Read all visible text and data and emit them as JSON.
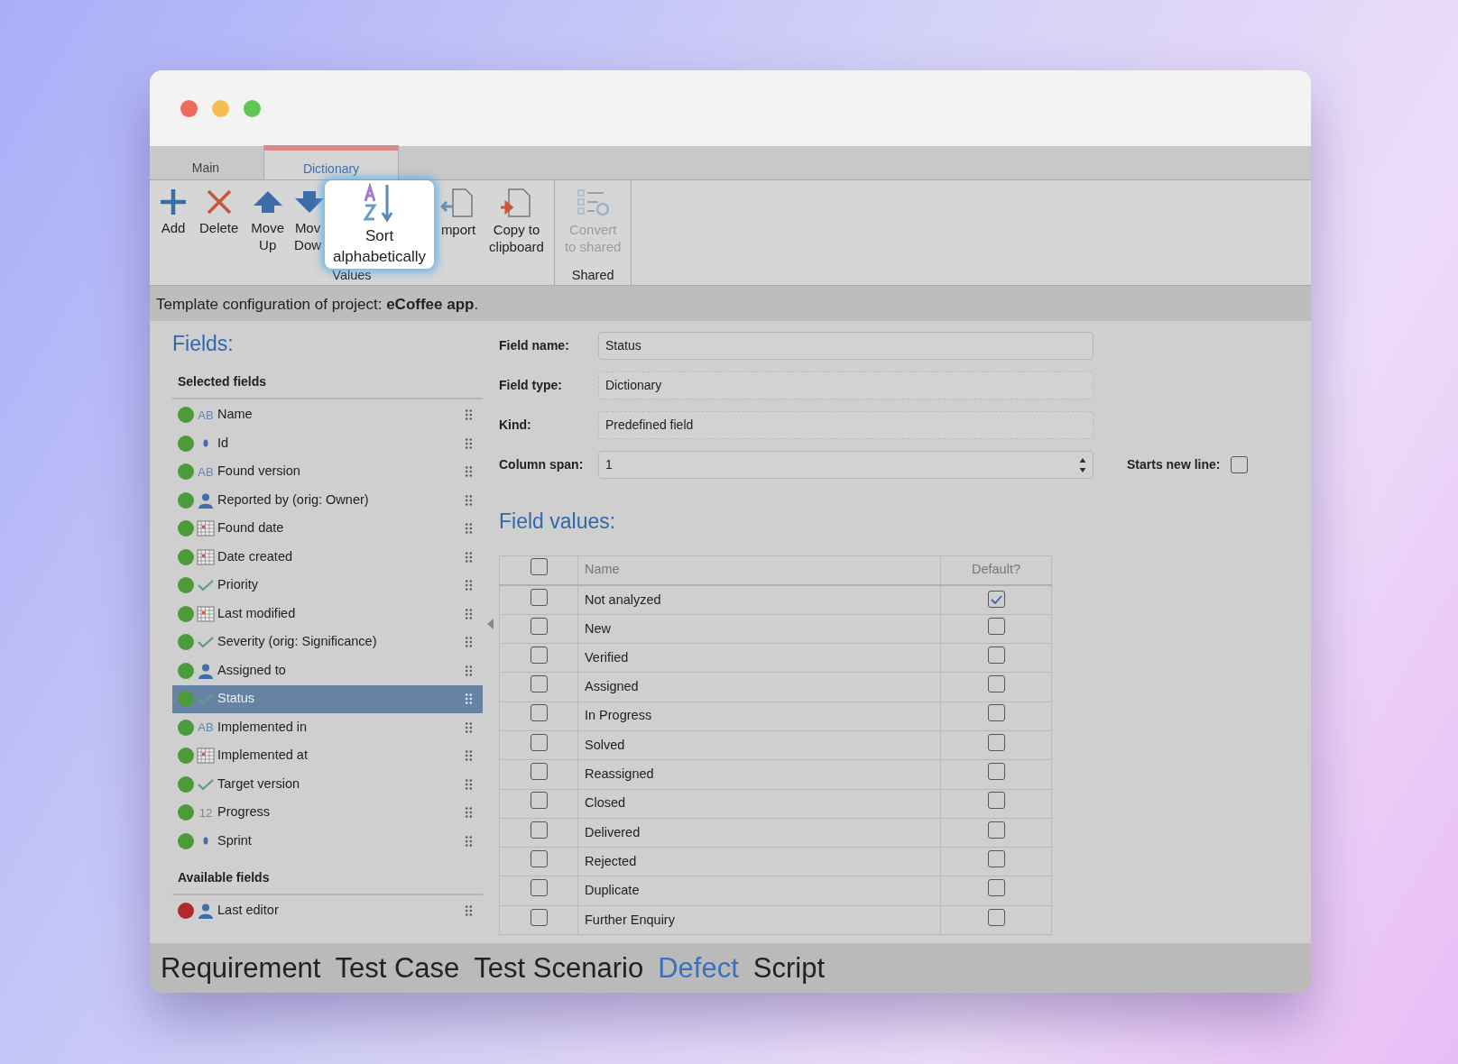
{
  "tabs": [
    {
      "label": "Main",
      "selected": false
    },
    {
      "label": "Dictionary",
      "selected": true
    }
  ],
  "toolbar": {
    "groups": [
      {
        "label": "Values",
        "buttons": [
          {
            "kind": "add",
            "label": "Add",
            "disabled": false,
            "magnified": false
          },
          {
            "kind": "delete",
            "label": "Delete",
            "disabled": false,
            "magnified": false
          },
          {
            "kind": "up",
            "label": "Move\nUp",
            "disabled": false,
            "magnified": false
          },
          {
            "kind": "down",
            "label": "Mov\nDow",
            "disabled": false,
            "magnified": false
          },
          {
            "kind": "sort",
            "label": "Sort\nalphabetically",
            "disabled": false,
            "magnified": true
          },
          {
            "kind": "import",
            "label": "mport",
            "disabled": false,
            "magnified": false
          },
          {
            "kind": "copy",
            "label": "Copy to\nclipboard",
            "disabled": false,
            "magnified": false
          }
        ]
      },
      {
        "label": "Shared",
        "buttons": [
          {
            "kind": "convert",
            "label": "Convert\nto shared",
            "disabled": true,
            "magnified": false
          }
        ]
      }
    ]
  },
  "info": "Template configuration of project: **eCoffee app**.",
  "fields": {
    "title": "Fields:",
    "groups": [
      {
        "title": "Selected fields",
        "items": [
          {
            "name": "Name",
            "color": "#4c9a3a",
            "kind": "text",
            "badge": "AB",
            "selected": false
          },
          {
            "name": "Id",
            "color": "#4c9a3a",
            "kind": "dot",
            "selected": false
          },
          {
            "name": "Found version",
            "color": "#4c9a3a",
            "kind": "text",
            "badge": "AB",
            "selected": false
          },
          {
            "name": "Reported by (orig: Owner)",
            "color": "#4c9a3a",
            "kind": "user",
            "selected": false
          },
          {
            "name": "Found date",
            "color": "#4c9a3a",
            "kind": "date",
            "selected": false
          },
          {
            "name": "Date created",
            "color": "#4c9a3a",
            "kind": "date",
            "selected": false
          },
          {
            "name": "Priority",
            "color": "#4c9a3a",
            "kind": "check",
            "selected": false
          },
          {
            "name": "Last modified",
            "color": "#4c9a3a",
            "kind": "date",
            "selected": false
          },
          {
            "name": "Severity (orig: Significance)",
            "color": "#4c9a3a",
            "kind": "check",
            "selected": false
          },
          {
            "name": "Assigned to",
            "color": "#4c9a3a",
            "kind": "user",
            "selected": false
          },
          {
            "name": "Status",
            "color": "#4c9a3a",
            "kind": "check",
            "selected": true
          },
          {
            "name": "Implemented in",
            "color": "#4c9a3a",
            "kind": "text",
            "badge": "AB",
            "selected": false
          },
          {
            "name": "Implemented at",
            "color": "#4c9a3a",
            "kind": "date",
            "selected": false
          },
          {
            "name": "Target version",
            "color": "#4c9a3a",
            "kind": "check",
            "selected": false
          },
          {
            "name": "Progress",
            "color": "#4c9a3a",
            "kind": "number",
            "badge": "12",
            "selected": false
          },
          {
            "name": "Sprint",
            "color": "#4c9a3a",
            "kind": "dot",
            "selected": false
          }
        ]
      },
      {
        "title": "Available fields",
        "items": [
          {
            "name": "Last editor",
            "color": "#b3282d",
            "kind": "user",
            "selected": false
          }
        ]
      }
    ]
  },
  "form": {
    "fields": [
      {
        "label": "Field name:",
        "value": "Status",
        "kind": "text"
      },
      {
        "label": "Field type:",
        "value": "Dictionary",
        "kind": "readonly"
      },
      {
        "label": "Kind:",
        "value": "Predefined field",
        "kind": "readonly"
      },
      {
        "label": "Column span:",
        "value": "1",
        "kind": "number"
      }
    ],
    "starts_new_line": {
      "label": "Starts new line:",
      "checked": false
    }
  },
  "values": {
    "title": "Field values:",
    "header_checked": false,
    "columns": [
      "Name",
      "Default?"
    ],
    "rows": [
      {
        "name": "Not analyzed",
        "checked": false,
        "default": true
      },
      {
        "name": "New",
        "checked": false,
        "default": false
      },
      {
        "name": "Verified",
        "checked": false,
        "default": false
      },
      {
        "name": "Assigned",
        "checked": false,
        "default": false
      },
      {
        "name": "In Progress",
        "checked": false,
        "default": false
      },
      {
        "name": "Solved",
        "checked": false,
        "default": false
      },
      {
        "name": "Reassigned",
        "checked": false,
        "default": false
      },
      {
        "name": "Closed",
        "checked": false,
        "default": false
      },
      {
        "name": "Delivered",
        "checked": false,
        "default": false
      },
      {
        "name": "Rejected",
        "checked": false,
        "default": false
      },
      {
        "name": "Duplicate",
        "checked": false,
        "default": false
      },
      {
        "name": "Further Enquiry",
        "checked": false,
        "default": false
      }
    ]
  },
  "bottom_tabs": [
    {
      "label": "Requirement",
      "selected": false
    },
    {
      "label": "Test Case",
      "selected": false
    },
    {
      "label": "Test Scenario",
      "selected": false
    },
    {
      "label": "Defect",
      "selected": true
    },
    {
      "label": "Script",
      "selected": false
    }
  ]
}
